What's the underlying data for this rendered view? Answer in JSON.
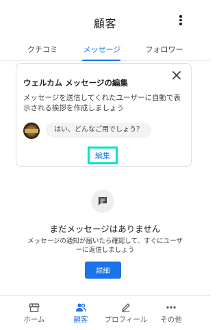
{
  "header": {
    "title": "顧客",
    "more_icon": "more-vert-icon"
  },
  "tabs": [
    {
      "label": "クチコミ",
      "active": false
    },
    {
      "label": "メッセージ",
      "active": true
    },
    {
      "label": "フォロワー",
      "active": false
    }
  ],
  "welcome_card": {
    "title": "ウェルカム メッセージの編集",
    "description": "メッセージを送信してくれたユーザーに自動で表示される挨拶を作成しましょう",
    "sample_message": "はい、どんなご用でしょう？",
    "edit_label": "編集",
    "close_icon": "close-icon"
  },
  "empty_state": {
    "icon": "chat-icon",
    "title": "まだメッセージはありません",
    "description": "メッセージの通知が届いたら確認して、すぐにユーザーに返信しましょう",
    "button_label": "詳細"
  },
  "bottom_nav": [
    {
      "label": "ホーム",
      "icon": "store-icon",
      "active": false
    },
    {
      "label": "顧客",
      "icon": "people-icon",
      "active": true
    },
    {
      "label": "プロフィール",
      "icon": "edit-pencil-icon",
      "active": false
    },
    {
      "label": "その他",
      "icon": "more-horiz-icon",
      "active": false
    }
  ],
  "colors": {
    "accent": "#1a73e8",
    "highlight": "#00e5c8",
    "text": "#202124",
    "muted": "#5f6368"
  }
}
